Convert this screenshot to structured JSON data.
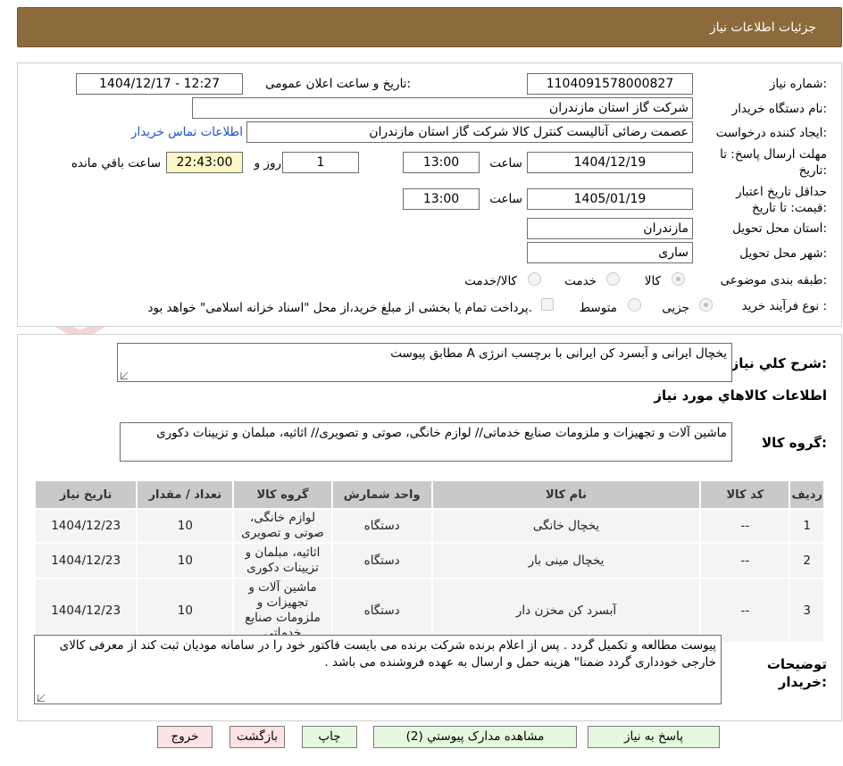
{
  "header": {
    "title": "جزئیات اطلاعات نیاز"
  },
  "watermark": {
    "text": "AriaTender.neT"
  },
  "fields": {
    "need_number_label": "شماره نیاز:",
    "need_number": "1104091578000827",
    "announce_label": "تاریخ و ساعت اعلان عمومی:",
    "announce_value": "1404/12/17 - 12:27",
    "buyer_org_label": "نام دستگاه خریدار:",
    "buyer_org": "شرکت گاز استان مازندران",
    "requester_label": "ایجاد کننده درخواست:",
    "requester": "عصمت رضائی آنالیست کنترل کالا شرکت گاز استان مازندران",
    "contact_link": "اطلاعات تماس خریدار",
    "deadline_label": "مهلت ارسال پاسخ: تا تاریخ:",
    "deadline_date": "1404/12/19",
    "time_label": "ساعت",
    "deadline_time": "13:00",
    "days_value": "1",
    "days_label": "روز و",
    "remaining_time": "22:43:00",
    "remaining_label": "ساعت باقي مانده",
    "validity_label": "حداقل تاریخ اعتبار قیمت: تا تاریخ:",
    "validity_date": "1405/01/19",
    "validity_time": "13:00",
    "province_label": "استان محل تحویل:",
    "province": "مازندران",
    "city_label": "شهر محل تحویل:",
    "city": "ساری",
    "category_label": "طبقه بندی موضوعی:",
    "category_options": [
      "کالا",
      "خدمت",
      "کالا/خدمت"
    ],
    "process_label": "نوع فرآیند خرید :",
    "process_options": [
      "جزیی",
      "متوسط"
    ],
    "payment_note": "پرداخت تمام یا بخشی از مبلغ خرید،از محل \"اسناد خزانه اسلامی\" خواهد بود."
  },
  "summary": {
    "label": "شرح کلي نياز:",
    "text": "یخچال ایرانی و آبسرد کن ایرانی با برچسب انرژی A مطابق پیوست"
  },
  "goods_section": {
    "title": "اطلاعات کالاهاي مورد نياز",
    "group_label": "گروه کالا:",
    "group_text": "ماشین آلات و تجهیزات و ملزومات صنایع خدماتی// لوازم خانگی، صوتی و تصویری// اثاثیه، مبلمان و تزیینات دکوری"
  },
  "table": {
    "headers": [
      "رديف",
      "کد کالا",
      "نام کالا",
      "واحد شمارش",
      "گروه کالا",
      "تعداد / مقدار",
      "تاريخ نياز"
    ],
    "rows": [
      [
        "1",
        "--",
        "یخچال خانگی",
        "دستگاه",
        "لوازم خانگی، صوتی و تصویری",
        "10",
        "1404/12/23"
      ],
      [
        "2",
        "--",
        "یخچال مینی بار",
        "دستگاه",
        "اثاثیه، مبلمان و تزیینات دکوری",
        "10",
        "1404/12/23"
      ],
      [
        "3",
        "--",
        "آبسرد کن مخزن دار",
        "دستگاه",
        "ماشین آلات و تجهیزات و ملزومات صنایع خدماتی",
        "10",
        "1404/12/23"
      ]
    ]
  },
  "notes": {
    "label": "توضیحات خریدار:",
    "text": "پیوست مطالعه و تکمیل گردد . پس از اعلام برنده شرکت برنده می بایست فاکتور خود را در سامانه مودیان ثبت کند از معرفی کالای خارجی خودداری گردد ضمنا\" هزینه حمل و ارسال به عهده فروشنده می باشد ."
  },
  "buttons": {
    "reply": "پاسخ به نیاز",
    "attachments": "مشاهده مدارک پیوستي (2)",
    "print": "چاپ",
    "back": "بازگشت",
    "exit": "خروج"
  }
}
